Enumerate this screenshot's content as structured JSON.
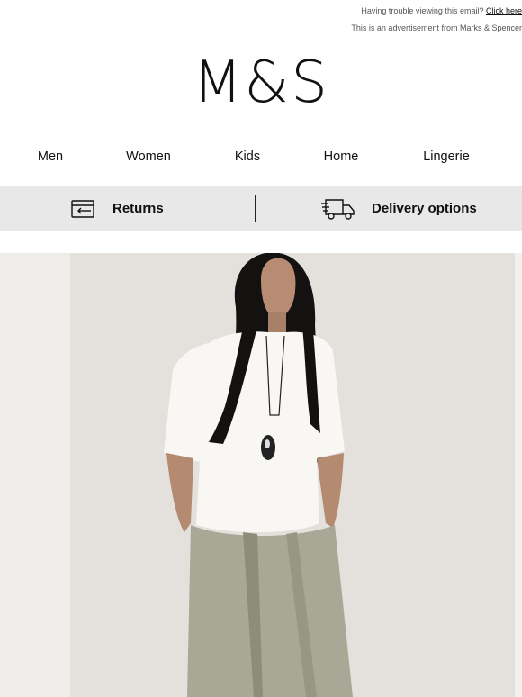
{
  "preheader": {
    "trouble_text": "Having trouble viewing this email?",
    "click_link": "Click here",
    "advert_text": "This is an advertisement from Marks & Spencer"
  },
  "brand": {
    "logo": "M&S"
  },
  "nav": {
    "items": [
      {
        "label": "Men"
      },
      {
        "label": "Women"
      },
      {
        "label": "Kids"
      },
      {
        "label": "Home"
      },
      {
        "label": "Lingerie"
      }
    ]
  },
  "services": {
    "returns_label": "Returns",
    "delivery_label": "Delivery options",
    "returns_icon": "returns-card-icon",
    "delivery_icon": "delivery-truck-icon"
  },
  "colors": {
    "band_background": "#e8e8e8",
    "text": "#111111"
  }
}
